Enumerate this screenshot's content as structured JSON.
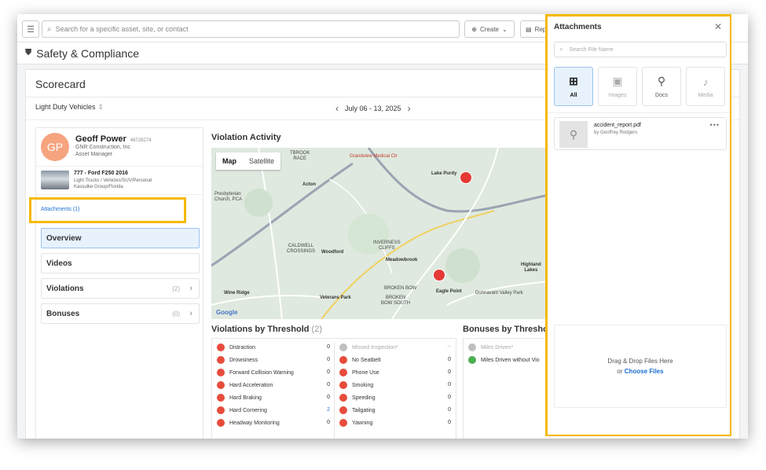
{
  "topbar": {
    "search_placeholder": "Search for a specific asset, site, or contact",
    "create_label": "Create",
    "rep_label": "Rep"
  },
  "header": {
    "title": "Safety & Compliance"
  },
  "scorecard": {
    "title": "Scorecard",
    "vehicle_type": "Light Duty Vehicles",
    "date_range": "July 06 - 13, 2025"
  },
  "profile": {
    "initials": "GP",
    "name": "Geoff Power",
    "id": "46728274",
    "company": "GNR Construction, Inc",
    "role": "Asset Manager",
    "truck_name": "777 - Ford F250 2016",
    "truck_type": "Light Trucks / Vehicles/SUV/Personal",
    "truck_group": "Kassulke Group/Florida",
    "attachments_link": "Attachments (1)"
  },
  "nav": [
    {
      "label": "Overview",
      "count": ""
    },
    {
      "label": "Videos",
      "count": ""
    },
    {
      "label": "Violations",
      "count": "(2)"
    },
    {
      "label": "Bonuses",
      "count": "(0)"
    }
  ],
  "violation_activity": {
    "title": "Violation Activity",
    "map_tab": "Map",
    "satellite_tab": "Satellite",
    "labels": {
      "grandview": "Grandview Medical Ctr",
      "acton": "Acton",
      "lakepurdy": "Lake Purdy",
      "presbyterian": "Presbyterian\nChurch, PCA",
      "caldwell": "CALDWELL\nCROSSINGS",
      "woodford": "Woodford",
      "inverness": "INVERNESS\nCLIFFS",
      "meadowbrook": "Meadowbrook",
      "wineridge": "Wine Ridge",
      "veterans": "Veterans Park",
      "brokenbow": "BROKEN BOW",
      "brokenbowsouth": "BROKEN\nBOW SOUTH",
      "eaglepoint": "Eagle Point",
      "dunnavant": "Dunnavant Valley Park",
      "highland": "Highland\nLakes",
      "tbrook": "TBROOK\nRACE"
    },
    "google": "Google"
  },
  "violations_threshold": {
    "title": "Violations by Threshold",
    "count": "(2)",
    "left": [
      {
        "label": "Distraction",
        "value": "0"
      },
      {
        "label": "Drowsiness",
        "value": "0"
      },
      {
        "label": "Forward Collision Warning",
        "value": "0"
      },
      {
        "label": "Hard Acceleration",
        "value": "0"
      },
      {
        "label": "Hard Braking",
        "value": "0"
      },
      {
        "label": "Hard Cornering",
        "value": "2"
      },
      {
        "label": "Headway Monitoring",
        "value": "0"
      }
    ],
    "right": [
      {
        "label": "Missed Inspection*",
        "value": "--"
      },
      {
        "label": "No Seatbelt",
        "value": "0"
      },
      {
        "label": "Phone Use",
        "value": "0"
      },
      {
        "label": "Smoking",
        "value": "0"
      },
      {
        "label": "Speeding",
        "value": "0"
      },
      {
        "label": "Tailgating",
        "value": "0"
      },
      {
        "label": "Yawning",
        "value": "0"
      }
    ]
  },
  "bonuses_threshold": {
    "title": "Bonuses by Threshold",
    "rows": [
      {
        "label": "Miles Driven*"
      },
      {
        "label": "Miles Driven without Vio"
      }
    ]
  },
  "attachments": {
    "title": "Attachments",
    "search_placeholder": "Search File Name",
    "tabs": [
      "All",
      "Images",
      "Docs",
      "Media"
    ],
    "file_name": "accident_report.pdf",
    "file_by": "by Geoffrey Rodgers",
    "drop_text": "Drag & Drop Files Here",
    "or_text": "or",
    "choose_text": "Choose Files"
  },
  "colors": {
    "highlight": "#f5b800",
    "accent": "#1a6fd1",
    "violation": "#e74c3c"
  }
}
